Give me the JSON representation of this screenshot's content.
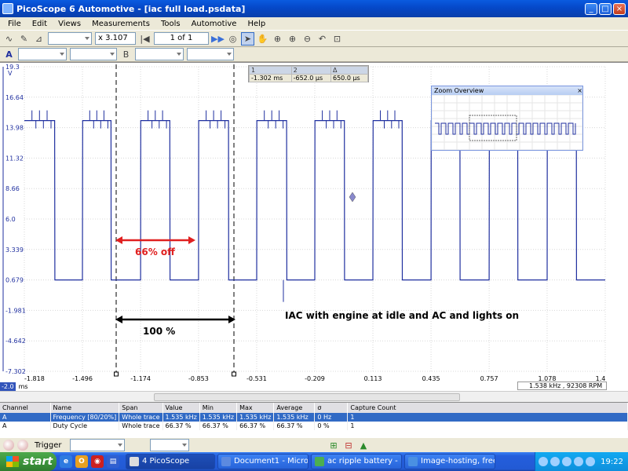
{
  "window": {
    "title": "PicoScope 6 Automotive - [iac full load.psdata]"
  },
  "menu": [
    "File",
    "Edit",
    "Views",
    "Measurements",
    "Tools",
    "Automotive",
    "Help"
  ],
  "toolbar": {
    "zoom_factor": "x 3.107",
    "buffer_page": "1 of 1"
  },
  "ruler": {
    "headers": [
      "1",
      "2",
      "Δ"
    ],
    "values": [
      "-1.302 ms",
      "-652.0 µs",
      "650.0 µs"
    ]
  },
  "zoom_overview": {
    "title": "Zoom Overview"
  },
  "chart_data": {
    "type": "line",
    "ylabel": "V",
    "xlabel": "ms",
    "x_ticks": [
      "-1.818",
      "-1.496",
      "-1.174",
      "-0.853",
      "-0.531",
      "-0.209",
      "0.113",
      "0.435",
      "0.757",
      "1.078",
      "1.4"
    ],
    "y_ticks": [
      "19.3",
      "16.64",
      "13.98",
      "11.32",
      "8.66",
      "6.0",
      "3.339",
      "0.679",
      "-1.981",
      "-4.642",
      "-7.302"
    ],
    "xlim": [
      -1.818,
      1.4
    ],
    "ylim": [
      -7.302,
      19.3
    ],
    "grid": true,
    "series": [
      {
        "x": [
          -1.818,
          -1.65,
          -1.649,
          -1.496,
          -1.495,
          -1.338,
          -1.337,
          -1.174,
          -1.173,
          -1.012,
          -1.011,
          -0.853,
          -0.852,
          -0.687,
          -0.686,
          -0.531,
          -0.53,
          -0.365,
          -0.364,
          -0.209,
          -0.208,
          -0.045,
          -0.044,
          0.113,
          0.114,
          0.275,
          0.276,
          0.435,
          0.436,
          0.595,
          0.596,
          0.757,
          0.758,
          0.915,
          0.916,
          1.078,
          1.079,
          1.24,
          1.241,
          1.4
        ],
        "y": [
          14.6,
          14.6,
          0.679,
          0.679,
          14.6,
          14.6,
          0.679,
          0.679,
          14.6,
          14.6,
          0.679,
          0.679,
          14.6,
          14.6,
          0.679,
          0.679,
          14.6,
          14.6,
          0.679,
          0.679,
          14.6,
          14.6,
          0.679,
          0.679,
          14.6,
          14.6,
          0.679,
          0.679,
          14.6,
          14.6,
          0.679,
          0.679,
          14.6,
          14.6,
          0.679,
          0.679,
          14.6,
          14.6,
          0.679,
          0.679
        ]
      }
    ],
    "annotations": [
      {
        "text": "66% off",
        "color": "#E02020"
      },
      {
        "text": "100 %",
        "color": "#000000"
      },
      {
        "text": "IAC with engine at idle and AC and lights on",
        "color": "#000000"
      }
    ],
    "trace_color": "#1F2F9F"
  },
  "timebase_start": "-2.0",
  "rpm_readout": "1.538 kHz , 92308 RPM",
  "measurements": {
    "headers": [
      "Channel",
      "Name",
      "Span",
      "Value",
      "Min",
      "Max",
      "Average",
      "σ",
      "Capture Count"
    ],
    "rows": [
      [
        "A",
        "Frequency  [80/20%]",
        "Whole trace",
        "1.535 kHz",
        "1.535 kHz",
        "1.535 kHz",
        "1.535 kHz",
        "0 Hz",
        "1"
      ],
      [
        "A",
        "Duty Cycle",
        "Whole trace",
        "66.37 %",
        "66.37 %",
        "66.37 %",
        "66.37 %",
        "0 %",
        "1"
      ]
    ]
  },
  "trigger": {
    "label": "Trigger"
  },
  "taskbar": {
    "start": "start",
    "tasks": [
      "4 PicoScope",
      "Document1 - Micros...",
      "ac ripple battery - P...",
      "Image-hosting, free ..."
    ],
    "clock": "19:22"
  }
}
